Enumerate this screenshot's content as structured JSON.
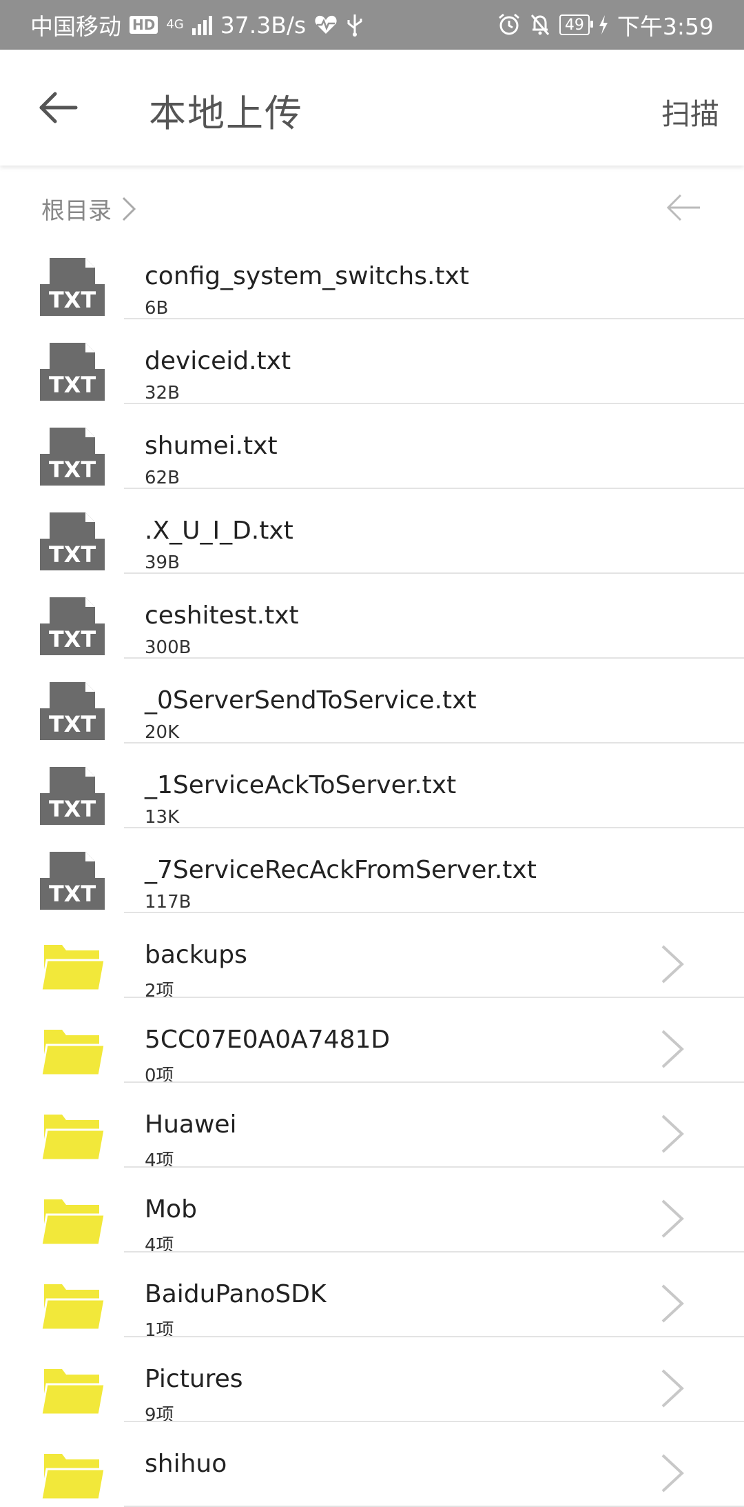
{
  "status_bar": {
    "carrier": "中国移动",
    "hd": "HD",
    "network": "4G",
    "speed": "37.3B/s",
    "battery": "49",
    "time": "下午3:59"
  },
  "app_bar": {
    "title": "本地上传",
    "scan_label": "扫描"
  },
  "breadcrumb": {
    "root": "根目录"
  },
  "files": [
    {
      "name": "config_system_switchs.txt",
      "size": "6B",
      "type": "txt"
    },
    {
      "name": "deviceid.txt",
      "size": "32B",
      "type": "txt"
    },
    {
      "name": "shumei.txt",
      "size": "62B",
      "type": "txt"
    },
    {
      "name": ".X_U_I_D.txt",
      "size": "39B",
      "type": "txt"
    },
    {
      "name": "ceshitest.txt",
      "size": "300B",
      "type": "txt"
    },
    {
      "name": "_0ServerSendToService.txt",
      "size": "20K",
      "type": "txt"
    },
    {
      "name": "_1ServiceAckToServer.txt",
      "size": "13K",
      "type": "txt"
    },
    {
      "name": "_7ServiceRecAckFromServer.txt",
      "size": "117B",
      "type": "txt"
    },
    {
      "name": "backups",
      "size": "2项",
      "type": "folder"
    },
    {
      "name": "5CC07E0A0A7481D",
      "size": "0项",
      "type": "folder"
    },
    {
      "name": "Huawei",
      "size": "4项",
      "type": "folder"
    },
    {
      "name": "Mob",
      "size": "4项",
      "type": "folder"
    },
    {
      "name": "BaiduPanoSDK",
      "size": "1项",
      "type": "folder"
    },
    {
      "name": "Pictures",
      "size": "9项",
      "type": "folder"
    },
    {
      "name": "shihuo",
      "size": "",
      "type": "folder"
    }
  ],
  "icons": {
    "txt_label": "TXT",
    "txt_color": "#6b6b6b",
    "folder_color": "#f2e83a"
  }
}
